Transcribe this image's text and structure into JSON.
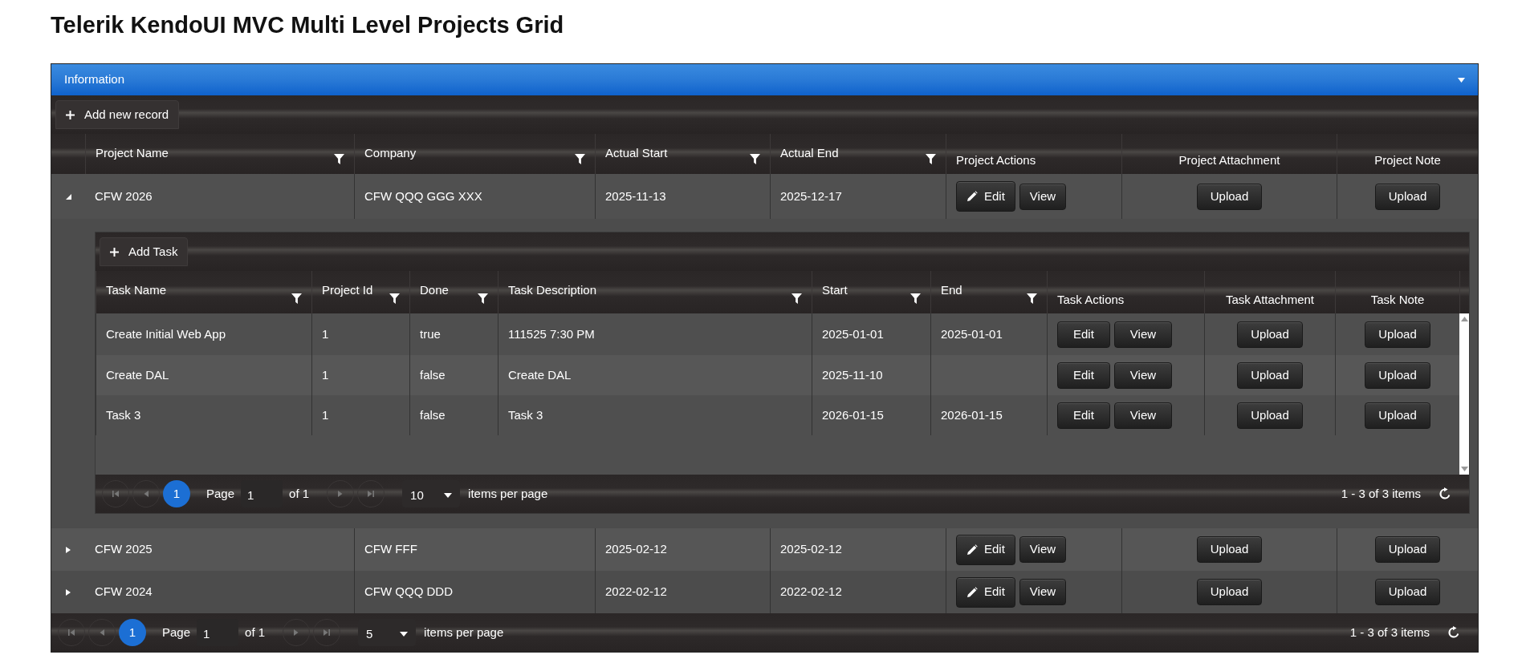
{
  "title": "Telerik KendoUI MVC Multi Level Projects Grid",
  "panel": {
    "title": "Information"
  },
  "toolbar": {
    "button": "Add new record"
  },
  "columns": [
    {
      "label": "Project Name",
      "filter": true,
      "kind": "text"
    },
    {
      "label": "Company",
      "filter": true,
      "kind": "text"
    },
    {
      "label": "Actual Start",
      "filter": true,
      "kind": "text"
    },
    {
      "label": "Actual End",
      "filter": true,
      "kind": "text"
    },
    {
      "label": "Project Actions",
      "filter": false,
      "kind": "actions"
    },
    {
      "label": "Project Attachment",
      "filter": false,
      "kind": "upload"
    },
    {
      "label": "Project Note",
      "filter": false,
      "kind": "upload"
    }
  ],
  "rows": [
    {
      "expanded": true,
      "cells": [
        "CFW 2026",
        "CFW QQQ GGG XXX",
        "2025-11-13",
        "2025-12-17",
        [
          "Edit",
          "View"
        ],
        "Upload",
        "Upload"
      ],
      "detail": {
        "toolbar": {
          "button": "Add Task"
        },
        "columns": [
          {
            "label": "Task Name",
            "filter": true,
            "kind": "text"
          },
          {
            "label": "Project Id",
            "filter": true,
            "kind": "text"
          },
          {
            "label": "Done",
            "filter": true,
            "kind": "text"
          },
          {
            "label": "Task Description",
            "filter": true,
            "kind": "text"
          },
          {
            "label": "Start",
            "filter": true,
            "kind": "text"
          },
          {
            "label": "End",
            "filter": true,
            "kind": "text"
          },
          {
            "label": "Task Actions",
            "filter": false,
            "kind": "actions"
          },
          {
            "label": "Task Attachment",
            "filter": false,
            "kind": "upload"
          },
          {
            "label": "Task Note",
            "filter": false,
            "kind": "upload"
          }
        ],
        "rows": [
          {
            "cells": [
              "Create Initial Web App",
              "1",
              "true",
              "111525 7:30 PM",
              "2025-01-01",
              "2025-01-01",
              [
                "Edit",
                "View"
              ],
              "Upload",
              "Upload"
            ]
          },
          {
            "cells": [
              "Create DAL",
              "1",
              "false",
              "Create DAL",
              "2025-11-10",
              null,
              [
                "Edit",
                "View"
              ],
              "Upload",
              "Upload"
            ]
          },
          {
            "cells": [
              "Task 3",
              "1",
              "false",
              "Task 3",
              "2026-01-15",
              "2026-01-15",
              [
                "Edit",
                "View"
              ],
              "Upload",
              "Upload"
            ]
          }
        ],
        "pager": {
          "current": "1",
          "page_label": "Page",
          "page_value": "1",
          "of": "of 1",
          "page_size": "10",
          "per_page_label": "items per page",
          "summary": "1 - 3 of 3 items"
        }
      }
    },
    {
      "expanded": false,
      "cells": [
        "CFW 2025",
        "CFW FFF",
        "2025-02-12",
        "2025-02-12",
        [
          "Edit",
          "View"
        ],
        "Upload",
        "Upload"
      ]
    },
    {
      "expanded": false,
      "cells": [
        "CFW 2024",
        "CFW QQQ DDD",
        "2022-02-12",
        "2022-02-12",
        [
          "Edit",
          "View"
        ],
        "Upload",
        "Upload"
      ]
    }
  ],
  "pager": {
    "current": "1",
    "page_label": "Page",
    "page_value": "1",
    "of": "of 1",
    "page_size": "5",
    "per_page_label": "items per page",
    "summary": "1 - 3 of 3 items"
  }
}
